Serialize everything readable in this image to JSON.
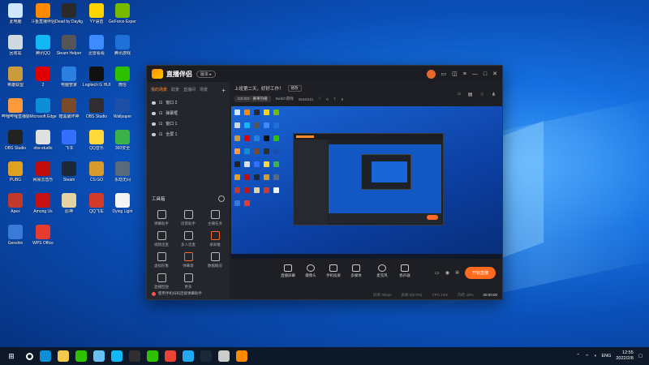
{
  "desktop": {
    "icons": [
      {
        "label": "此电脑",
        "color": "#cfe6ff"
      },
      {
        "label": "斗鱼直播伴侣",
        "color": "#ff8a00"
      },
      {
        "label": "Dead by Daylight",
        "color": "#2a2a2a"
      },
      {
        "label": "YY语音",
        "color": "#ffd400"
      },
      {
        "label": "GeForce Experience",
        "color": "#76b900"
      },
      {
        "label": "回收站",
        "color": "#d0d8e0"
      },
      {
        "label": "腾讯QQ",
        "color": "#12b7f5"
      },
      {
        "label": "Steam Helper",
        "color": "#555555"
      },
      {
        "label": "迅雷看看",
        "color": "#3d8bff"
      },
      {
        "label": "腾讯游戏",
        "color": "#1e6fd6"
      },
      {
        "label": "英雄联盟",
        "color": "#c89b3c"
      },
      {
        "label": "2",
        "color": "#e00000"
      },
      {
        "label": "电脑管家",
        "color": "#2a7fe0"
      },
      {
        "label": "Logitech G HUB",
        "color": "#111111"
      },
      {
        "label": "微信",
        "color": "#2dc100"
      },
      {
        "label": "哔哩哔哩直播姬",
        "color": "#ff9a3c"
      },
      {
        "label": "Microsoft Edge",
        "color": "#0c8fd6"
      },
      {
        "label": "暗黑破坏神",
        "color": "#7a4a2a"
      },
      {
        "label": "OBS Studio",
        "color": "#302e31"
      },
      {
        "label": "Wallpaper",
        "color": "#1e4fa8"
      },
      {
        "label": "OBS Studio",
        "color": "#222222"
      },
      {
        "label": "obs-studio",
        "color": "#e0e0e0"
      },
      {
        "label": "飞书",
        "color": "#3370ff"
      },
      {
        "label": "QQ音乐",
        "color": "#ffd93a"
      },
      {
        "label": "360安全",
        "color": "#3cb34a"
      },
      {
        "label": "PUBG",
        "color": "#e0a020"
      },
      {
        "label": "网易云音乐",
        "color": "#c20c0c"
      },
      {
        "label": "Steam",
        "color": "#1b2838"
      },
      {
        "label": "CS:GO",
        "color": "#d69b2a"
      },
      {
        "label": "永劫无间",
        "color": "#5a6a7a"
      },
      {
        "label": "Apex",
        "color": "#c0392b"
      },
      {
        "label": "Among Us",
        "color": "#c51111"
      },
      {
        "label": "原神",
        "color": "#e6d3a3"
      },
      {
        "label": "QQ飞车",
        "color": "#d43a2a"
      },
      {
        "label": "Dying Light",
        "color": "#f5f5f5"
      },
      {
        "label": "Genshin",
        "color": "#3a7ad8"
      },
      {
        "label": "WPS Office",
        "color": "#e83a2f"
      }
    ]
  },
  "app": {
    "title": "直播伴侣",
    "version_btn": "版本 ▸",
    "sidebar": {
      "tabs": [
        "我的场景",
        "取景",
        "直播间",
        "场景"
      ],
      "add": "+",
      "scenes": [
        "窗口 2",
        "弹幕框",
        "窗口 1",
        "全屏 1"
      ],
      "tools_title": "工具箱",
      "tools": [
        "弹幕助手",
        "房管助手",
        "主播任务",
        "视频连麦",
        "多人连麦",
        "录屏推",
        "虚拟形象",
        "弹幕寄",
        "数据概览",
        "直播回放",
        "更多"
      ],
      "hint": "使用手机扫码连接弹幕助手"
    },
    "main": {
      "title": "上班第二天，好好工作！",
      "edit": "修改",
      "category": "CS:GO · 赛事热播",
      "channel": "Switch游戏",
      "viewers": "1644/211",
      "likes": "0",
      "shares": "0"
    },
    "controls": {
      "items": [
        "直播屏幕",
        "摄像头",
        "手机投屏",
        "多媒体",
        "麦克风",
        "扬声器"
      ],
      "start": "开始直播"
    },
    "status": {
      "items": [
        "码率 0kbps",
        "丢帧 0(0.0%)",
        "CPU 14%",
        "内存 43%"
      ],
      "record": "00:00:00"
    }
  },
  "taskbar": {
    "start_icon": "windows-icon",
    "apps": [
      {
        "name": "search-icon",
        "color": "#ffffff"
      },
      {
        "name": "edge-icon",
        "color": "#0c8fd6"
      },
      {
        "name": "explorer-icon",
        "color": "#f2c94c"
      },
      {
        "name": "xbox-icon",
        "color": "#2dc100"
      },
      {
        "name": "steam-icon",
        "color": "#66c0f4"
      },
      {
        "name": "qq-icon",
        "color": "#12b7f5"
      },
      {
        "name": "obs-icon",
        "color": "#302e31"
      },
      {
        "name": "wechat-icon",
        "color": "#2dc100"
      },
      {
        "name": "chrome-icon",
        "color": "#ea4335"
      },
      {
        "name": "vscode-icon",
        "color": "#23a9f2"
      },
      {
        "name": "steam-icon",
        "color": "#1b2838"
      },
      {
        "name": "clock-icon",
        "color": "#cccccc"
      },
      {
        "name": "douyu-icon",
        "color": "#ff8a00"
      }
    ],
    "lang": "ENG",
    "time": "12:55",
    "date": "2022/2/8"
  }
}
